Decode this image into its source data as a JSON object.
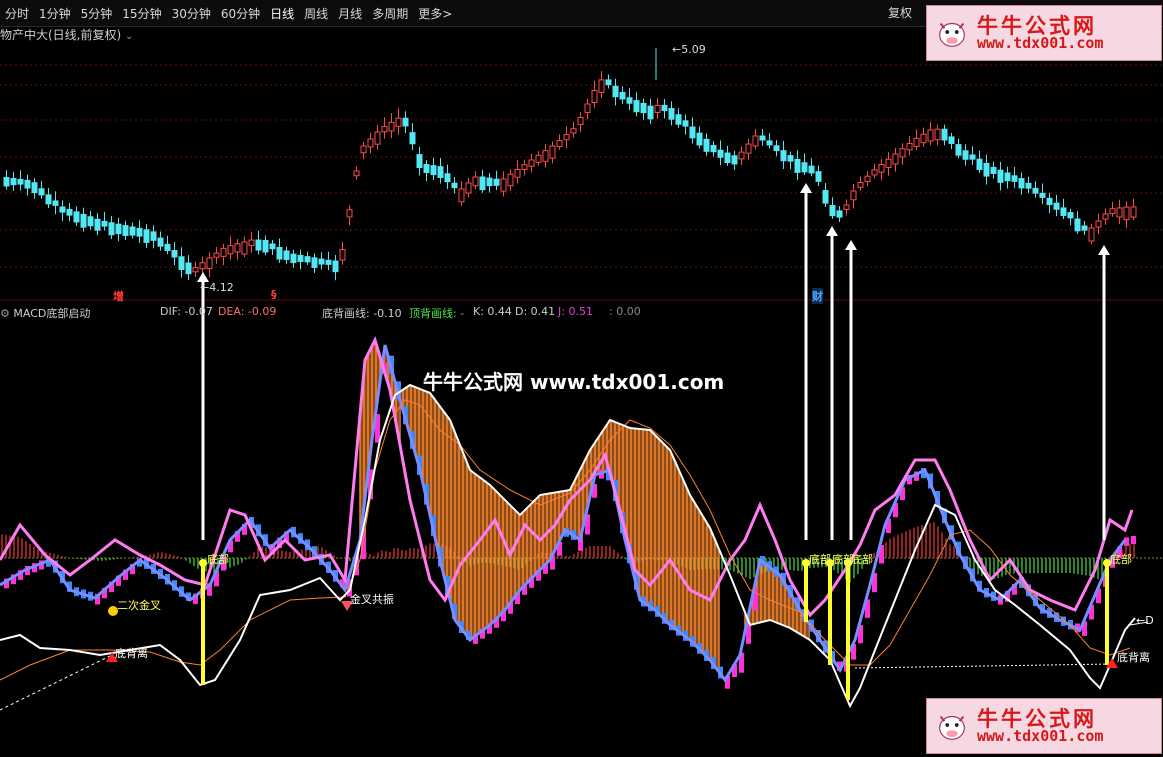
{
  "toolbar": {
    "timeframes": [
      "分时",
      "1分钟",
      "5分钟",
      "15分钟",
      "30分钟",
      "60分钟",
      "日线",
      "周线",
      "月线",
      "多周期"
    ],
    "more_label": "更多",
    "fuquan_label": "复权"
  },
  "price_panel": {
    "title": "物产中大(日线,前复权)",
    "high_label": "5.09",
    "low_label": "4.12",
    "markers": [
      {
        "text": "增",
        "color": "#ff3c3c"
      },
      {
        "text": "§",
        "color": "#ff3c3c"
      },
      {
        "text": "财",
        "color": "#4aa8ff"
      }
    ]
  },
  "watermark": "牛牛公式网 www.tdx001.com",
  "logo": {
    "cn": "牛牛公式网",
    "url": "www.tdx001.com"
  },
  "indicator": {
    "name": "MACD底部启动",
    "values": [
      {
        "text": "DIF: -0.07",
        "color": "#e6e6e6"
      },
      {
        "text": "DEA: -0.09",
        "color": "#ff7070"
      },
      {
        "text": "底背画线: -0.10",
        "color": "#e6e6e6"
      },
      {
        "text": "顶背画线: -",
        "color": "#4ce04c"
      },
      {
        "text": "K: 0.44",
        "color": "#e6e6e6"
      },
      {
        "text": "D: 0.41",
        "color": "#e6e6e6"
      },
      {
        "text": "J: 0.51",
        "color": "#e040e0"
      },
      {
        "text": ": 0.00",
        "color": "#888888"
      }
    ],
    "labels": [
      "二次金叉",
      "底背离",
      "金叉共振",
      "底部",
      "底部",
      "底部",
      "底部",
      "底部",
      "底背离"
    ],
    "edge_label": "←D"
  },
  "colors": {
    "up": "#ff4a4a",
    "down": "#54e8f5",
    "yellow": "#ffff30",
    "orange": "#ff8a30",
    "pink": "#ff7cf0",
    "magenta": "#ff32d8",
    "blue": "#3c8aff",
    "gridred": "#6a1010"
  }
}
